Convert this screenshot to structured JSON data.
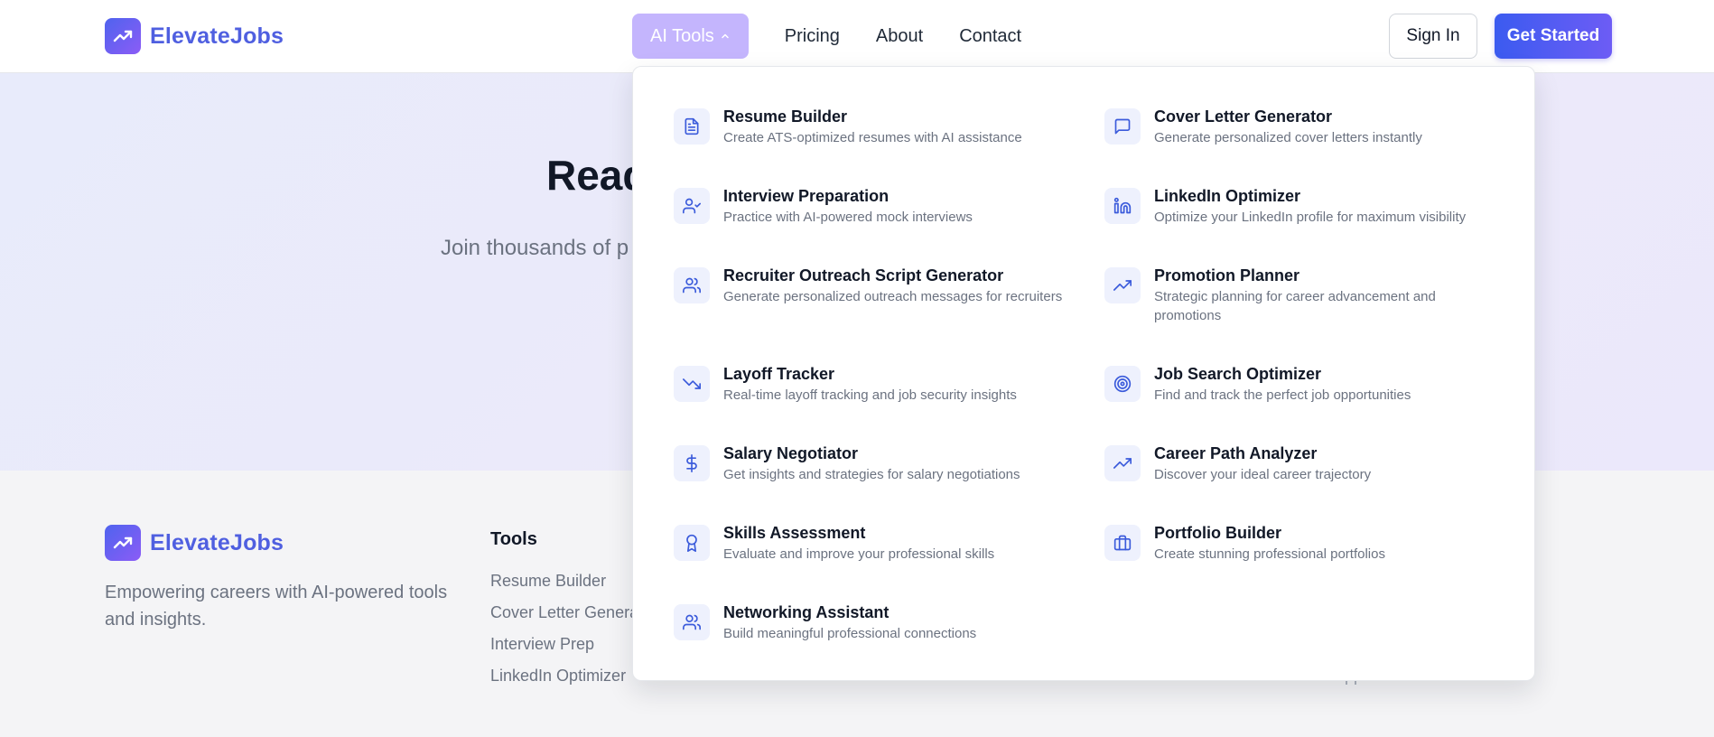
{
  "brand": {
    "name": "ElevateJobs",
    "icon": "trending-up-icon",
    "color": "#4f5fe0"
  },
  "nav": {
    "ai_tools": "AI Tools",
    "pricing": "Pricing",
    "about": "About",
    "contact": "Contact",
    "sign_in": "Sign In",
    "get_started": "Get Started"
  },
  "hero": {
    "title_visible": "Read",
    "subtitle_visible": "Join thousands of p"
  },
  "dropdown": {
    "items": [
      {
        "title": "Resume Builder",
        "desc": "Create ATS-optimized resumes with AI assistance",
        "icon": "document-icon"
      },
      {
        "title": "Cover Letter Generator",
        "desc": "Generate personalized cover letters instantly",
        "icon": "message-icon"
      },
      {
        "title": "Interview Preparation",
        "desc": "Practice with AI-powered mock interviews",
        "icon": "user-check-icon"
      },
      {
        "title": "LinkedIn Optimizer",
        "desc": "Optimize your LinkedIn profile for maximum visibility",
        "icon": "linkedin-icon"
      },
      {
        "title": "Recruiter Outreach Script Generator",
        "desc": "Generate personalized outreach messages for recruiters",
        "icon": "users-icon"
      },
      {
        "title": "Promotion Planner",
        "desc": "Strategic planning for career advancement and promotions",
        "icon": "trending-up-icon"
      },
      {
        "title": "Layoff Tracker",
        "desc": "Real-time layoff tracking and job security insights",
        "icon": "trending-down-icon"
      },
      {
        "title": "Job Search Optimizer",
        "desc": "Find and track the perfect job opportunities",
        "icon": "target-icon"
      },
      {
        "title": "Salary Negotiator",
        "desc": "Get insights and strategies for salary negotiations",
        "icon": "dollar-icon"
      },
      {
        "title": "Career Path Analyzer",
        "desc": "Discover your ideal career trajectory",
        "icon": "trending-up-icon"
      },
      {
        "title": "Skills Assessment",
        "desc": "Evaluate and improve your professional skills",
        "icon": "award-icon"
      },
      {
        "title": "Portfolio Builder",
        "desc": "Create stunning professional portfolios",
        "icon": "briefcase-icon"
      },
      {
        "title": "Networking Assistant",
        "desc": "Build meaningful professional connections",
        "icon": "users-icon"
      }
    ]
  },
  "footer": {
    "brand": "ElevateJobs",
    "description": "Empowering careers with AI-powered tools and insights.",
    "tools_title": "Tools",
    "tools_links": [
      "Resume Builder",
      "Cover Letter Generat",
      "Interview Prep",
      "LinkedIn Optimizer"
    ],
    "partial_link": "Contact Support"
  },
  "colors": {
    "accent": "#4f63ee",
    "nav_active_bg": "#c4b5fd",
    "icon_bg": "#eef1fd",
    "icon_stroke": "#3b5bdb"
  }
}
